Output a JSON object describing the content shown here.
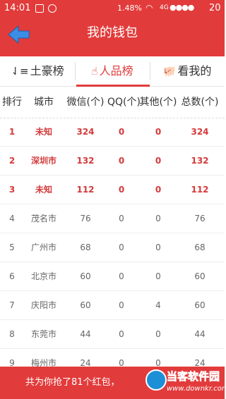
{
  "status_bar": {
    "time": "14:01",
    "speed": "1.48",
    "speed_unit": "%",
    "network": "4G",
    "battery": "20"
  },
  "header": {
    "title": "我的钱包",
    "back_icon": "back-arrow-icon"
  },
  "tabs": [
    {
      "label": "土豪榜",
      "icon": "sort-icon",
      "active": false
    },
    {
      "label": "人品榜",
      "icon": "thumbs-up-icon",
      "active": true
    },
    {
      "label": "看我的",
      "icon": "piggy-bank-icon",
      "active": false
    }
  ],
  "table": {
    "columns": [
      "排行",
      "城市",
      "微信(个)",
      "QQ(个)",
      "其他(个)",
      "总数(个)"
    ],
    "rows": [
      [
        "1",
        "未知",
        "324",
        "0",
        "0",
        "324"
      ],
      [
        "2",
        "深圳市",
        "132",
        "0",
        "0",
        "132"
      ],
      [
        "3",
        "未知",
        "112",
        "0",
        "0",
        "112"
      ],
      [
        "4",
        "茂名市",
        "76",
        "0",
        "0",
        "76"
      ],
      [
        "5",
        "广州市",
        "68",
        "0",
        "0",
        "68"
      ],
      [
        "6",
        "北京市",
        "60",
        "0",
        "0",
        "60"
      ],
      [
        "7",
        "庆阳市",
        "60",
        "0",
        "4",
        "60"
      ],
      [
        "8",
        "东莞市",
        "44",
        "0",
        "0",
        "44"
      ],
      [
        "9",
        "梅州市",
        "24",
        "0",
        "0",
        "24"
      ]
    ]
  },
  "footer": {
    "summary": "共为你抢了81个红包，"
  },
  "watermark": {
    "title": "当客软件园",
    "url": "www.downkr.com"
  },
  "colors": {
    "primary": "#e23b3b",
    "highlight_text": "#d43a3a"
  }
}
